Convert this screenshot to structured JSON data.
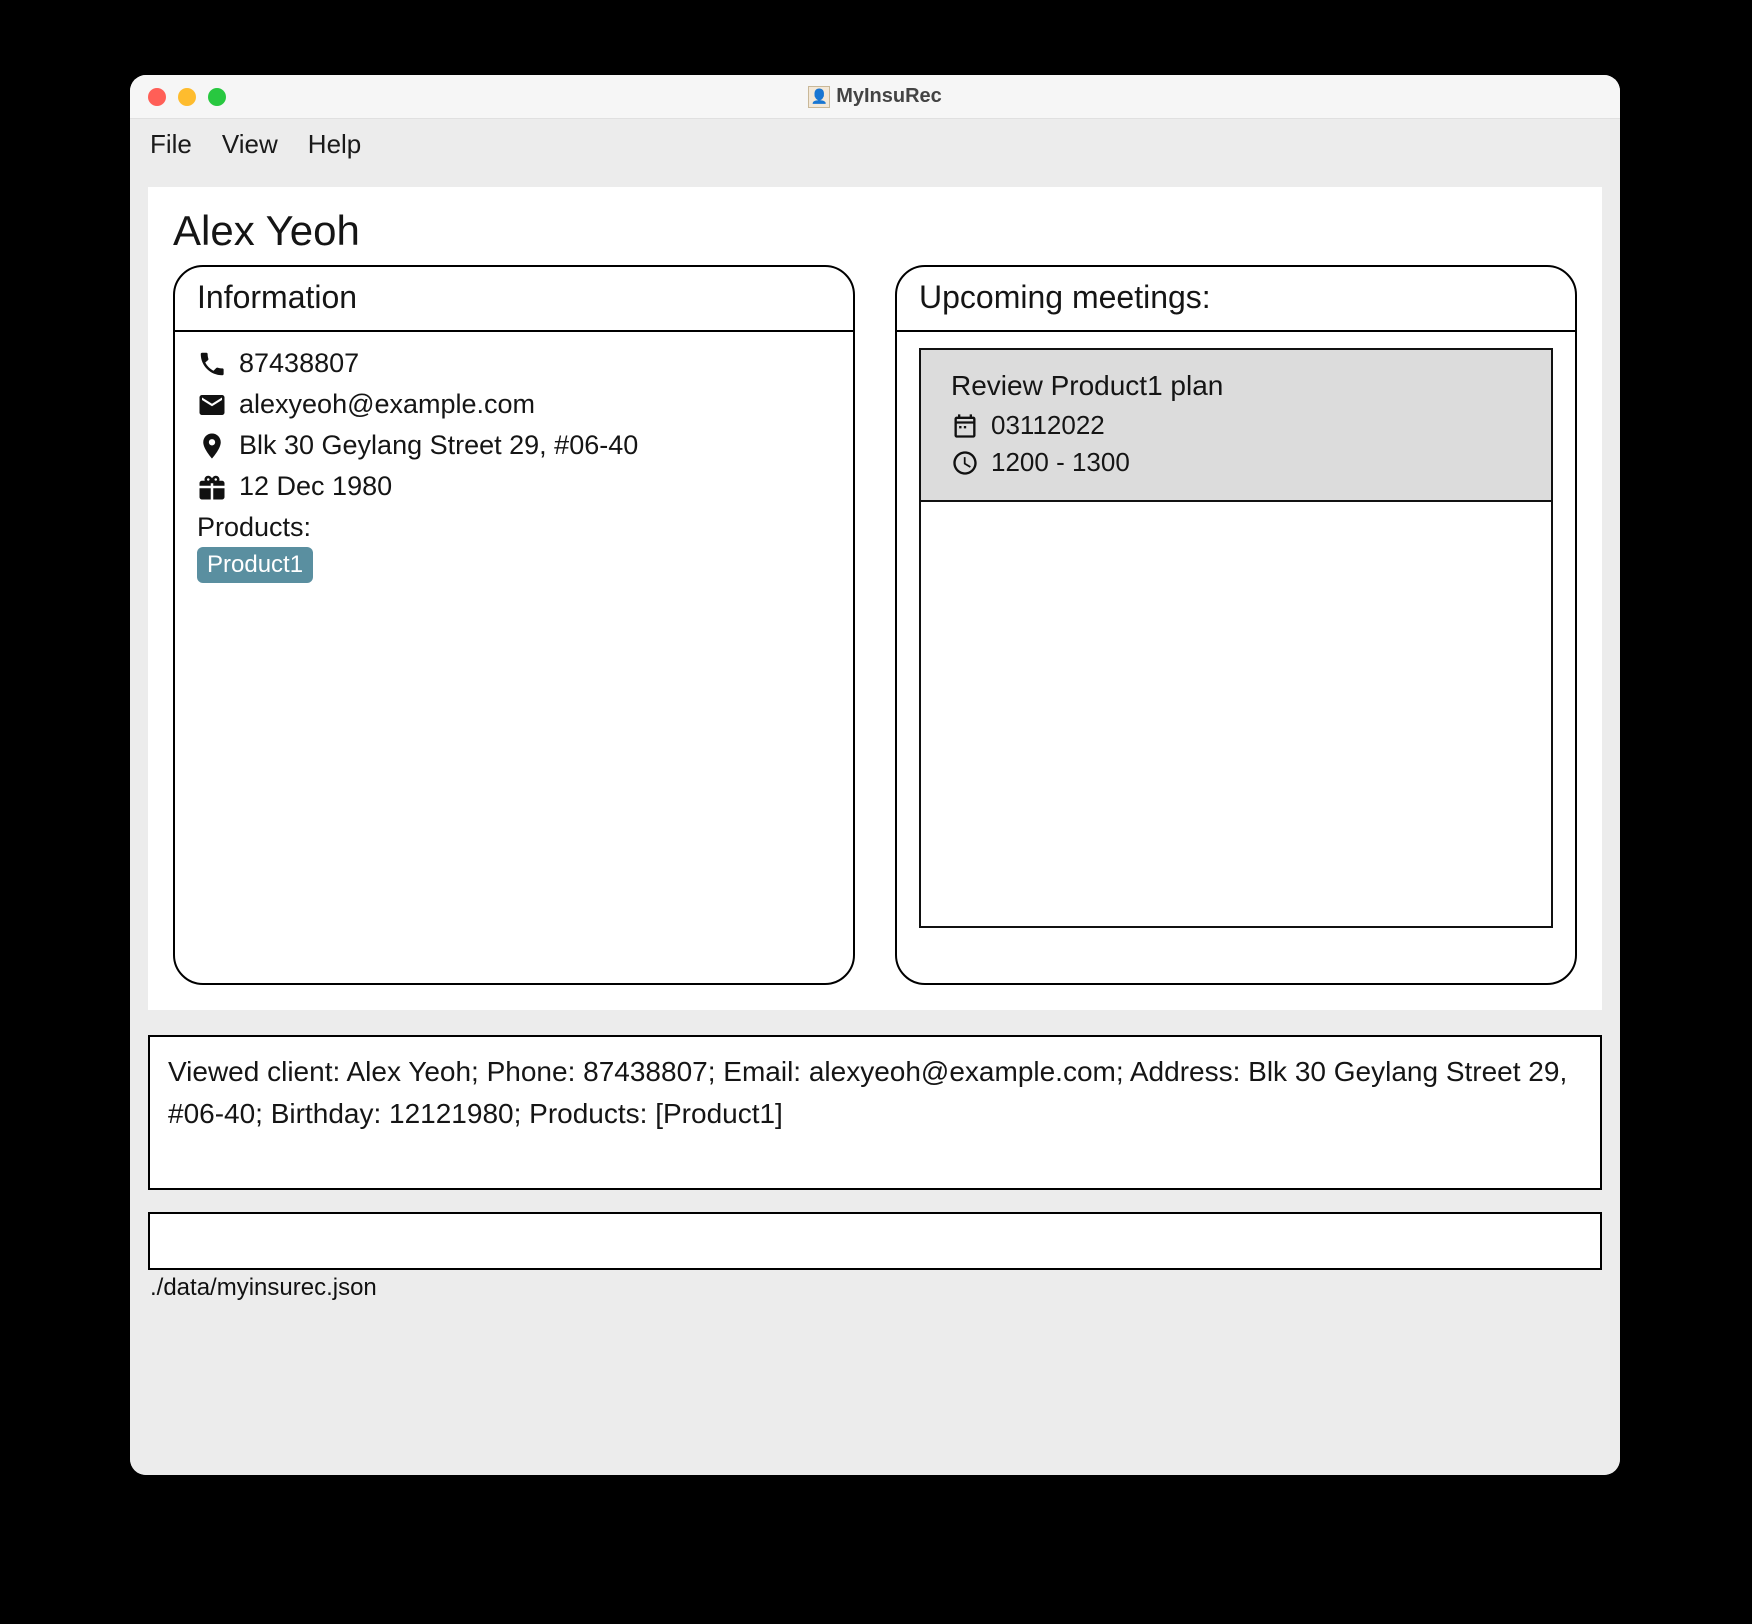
{
  "window": {
    "title": "MyInsuRec"
  },
  "menubar": {
    "file": "File",
    "view": "View",
    "help": "Help"
  },
  "client": {
    "name": "Alex Yeoh",
    "info_header": "Information",
    "phone": "87438807",
    "email": "alexyeoh@example.com",
    "address": "Blk 30 Geylang Street 29, #06-40",
    "birthday": "12 Dec 1980",
    "products_label": "Products:",
    "products": [
      "Product1"
    ]
  },
  "meetings": {
    "header": "Upcoming meetings:",
    "items": [
      {
        "title": "Review Product1 plan",
        "date": "03112022",
        "time": "1200 - 1300"
      }
    ]
  },
  "result": "Viewed client: Alex Yeoh; Phone: 87438807; Email: alexyeoh@example.com; Address: Blk 30 Geylang Street 29, #06-40; Birthday: 12121980; Products: [Product1]",
  "command": "",
  "statusbar": "./data/myinsurec.json"
}
